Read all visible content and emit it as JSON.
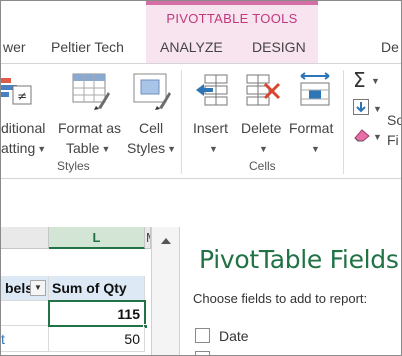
{
  "ribbon_tabs": {
    "context_title": "PIVOTTABLE TOOLS",
    "items": [
      {
        "label": "wer"
      },
      {
        "label": "Peltier Tech"
      },
      {
        "label": "ANALYZE"
      },
      {
        "label": "DESIGN"
      },
      {
        "label": "De"
      }
    ]
  },
  "styles_group": {
    "label": "Styles",
    "conditional_formatting": {
      "line1": "ditional",
      "line2": "atting"
    },
    "format_as_table": {
      "line1": "Format as",
      "line2": "Table"
    },
    "cell_styles": {
      "line1": "Cell",
      "line2": "Styles"
    }
  },
  "cells_group": {
    "label": "Cells",
    "insert": {
      "label": "Insert"
    },
    "delete": {
      "label": "Delete"
    },
    "format": {
      "label": "Format"
    }
  },
  "editing_group": {
    "sum_icon": "Σ",
    "sort_line1": "So",
    "sort_line2": "Fi"
  },
  "sheet": {
    "column_l_header": "L",
    "column_m_header": "M",
    "row_labels_header": "bels",
    "sum_header": "Sum of Qty",
    "values": [
      "115",
      "50"
    ],
    "row2_label": "t"
  },
  "pivot_pane": {
    "title": "PivotTable Fields",
    "subtitle": "Choose fields to add to report:",
    "fields": [
      {
        "label": "Date"
      }
    ]
  },
  "colors": {
    "accent_green": "#217346",
    "context_pink": "#c0397e"
  }
}
